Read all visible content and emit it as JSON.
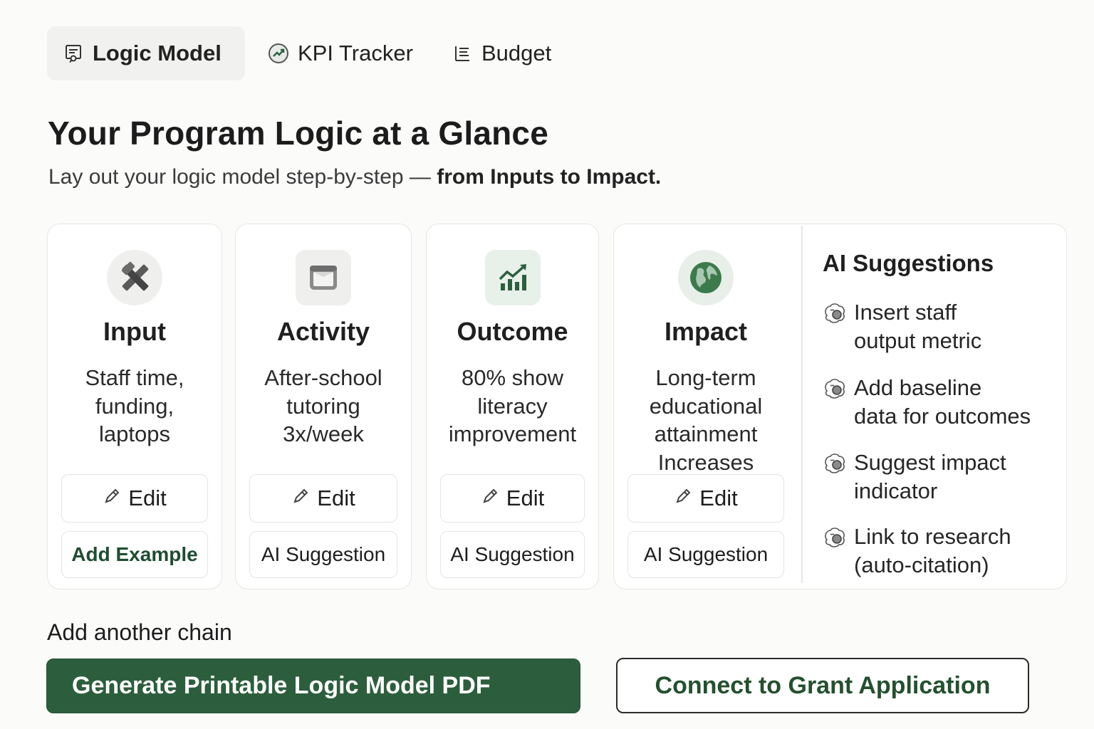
{
  "tabs": [
    {
      "label": "Logic Model",
      "icon": "logic-model-icon",
      "active": true
    },
    {
      "label": "KPI Tracker",
      "icon": "trend-chart-icon",
      "active": false
    },
    {
      "label": "Budget",
      "icon": "list-icon",
      "active": false
    }
  ],
  "header": {
    "title": "Your Program Logic at a Glance",
    "subtitle_plain": "Lay out your logic model step-by-step — ",
    "subtitle_strong": "from Inputs to Impact."
  },
  "cards": [
    {
      "title": "Input",
      "icon": "tools-icon",
      "desc": [
        "Staff time,",
        "funding,",
        "laptops"
      ],
      "edit_label": "Edit",
      "secondary_label": "Add Example"
    },
    {
      "title": "Activity",
      "icon": "calendar-box-icon",
      "desc": [
        "After-school",
        "tutoring",
        "3x/week"
      ],
      "edit_label": "Edit",
      "secondary_label": "AI Suggestion"
    },
    {
      "title": "Outcome",
      "icon": "growth-chart-icon",
      "desc": [
        "80% show",
        "literacy",
        "improvement"
      ],
      "edit_label": "Edit",
      "secondary_label": "AI Suggestion"
    },
    {
      "title": "Impact",
      "icon": "globe-icon",
      "desc": [
        "Long-term",
        "educational",
        "attainment",
        "Increases"
      ],
      "edit_label": "Edit",
      "secondary_label": "AI Suggestion"
    }
  ],
  "ai_suggestions": {
    "title": "AI Suggestions",
    "icon": "ai-brain-icon",
    "items": [
      [
        "Insert staff",
        "output metric"
      ],
      [
        "Add baseline",
        "data for outcomes"
      ],
      [
        "Suggest impact",
        "indicator"
      ],
      [
        "Link to research",
        "(auto-citation)"
      ]
    ]
  },
  "footer": {
    "add_chain_label": "Add another chain",
    "primary_button": "Generate Printable Logic Model PDF",
    "secondary_button": "Connect to Grant Application"
  },
  "colors": {
    "primary_green": "#2c5e3d",
    "accent_green": "#3c7a4c",
    "card_border": "#e6e6e3",
    "background": "#fbfbfa"
  }
}
